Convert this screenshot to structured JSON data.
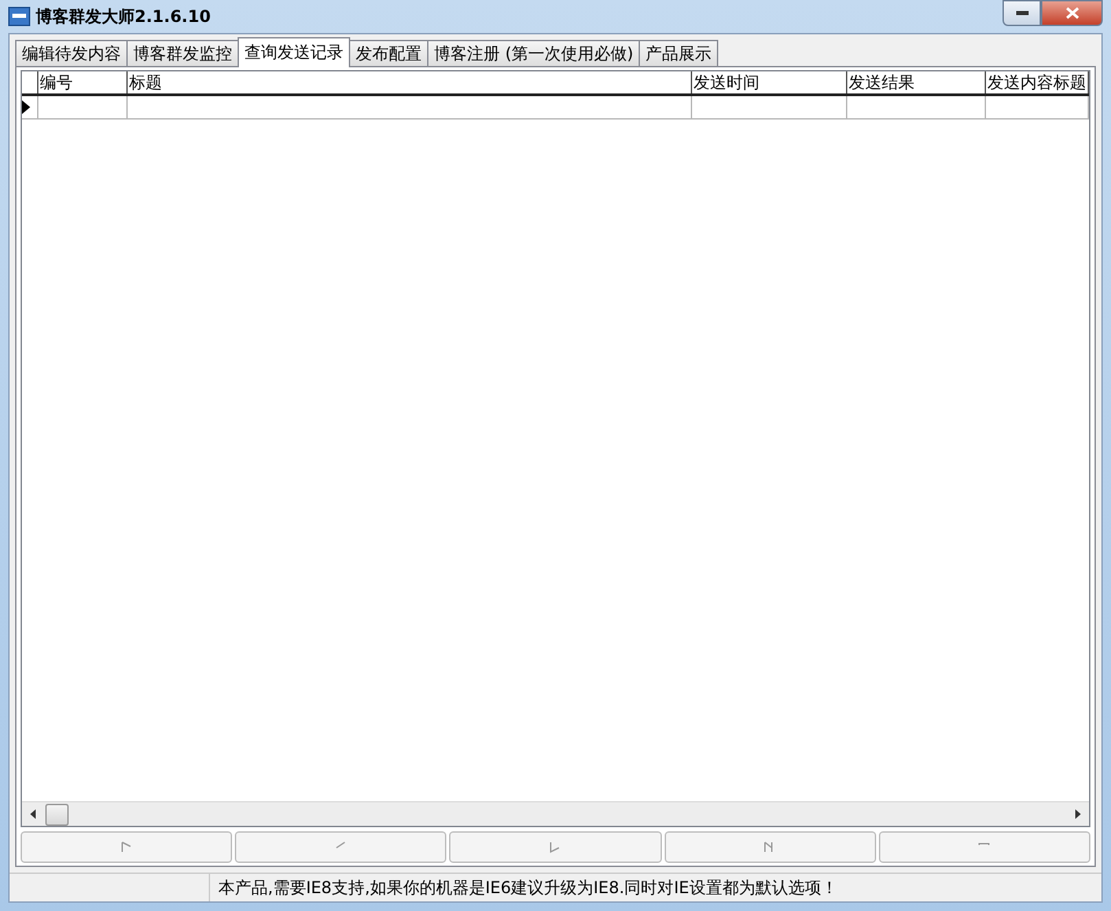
{
  "window": {
    "title": "博客群发大师2.1.6.10"
  },
  "tabs": [
    {
      "label": "编辑待发内容",
      "selected": false
    },
    {
      "label": "博客群发监控",
      "selected": false
    },
    {
      "label": "查询发送记录",
      "selected": true
    },
    {
      "label": "发布配置",
      "selected": false
    },
    {
      "label": "博客注册 (第一次使用必做)",
      "selected": false
    },
    {
      "label": "产品展示",
      "selected": false
    }
  ],
  "table": {
    "columns": [
      "编号",
      "标题",
      "发送时间",
      "发送结果",
      "发送内容标题"
    ],
    "current_row_marker": true
  },
  "nav_buttons": [
    {
      "kind": "first",
      "disabled": true
    },
    {
      "kind": "prev",
      "disabled": true
    },
    {
      "kind": "next",
      "disabled": true
    },
    {
      "kind": "last",
      "disabled": true
    },
    {
      "kind": "new",
      "disabled": true
    }
  ],
  "status_bar": {
    "message": "本产品,需要IE8支持,如果你的机器是IE6建议升级为IE8.同时对IE设置都为默认选项！"
  }
}
